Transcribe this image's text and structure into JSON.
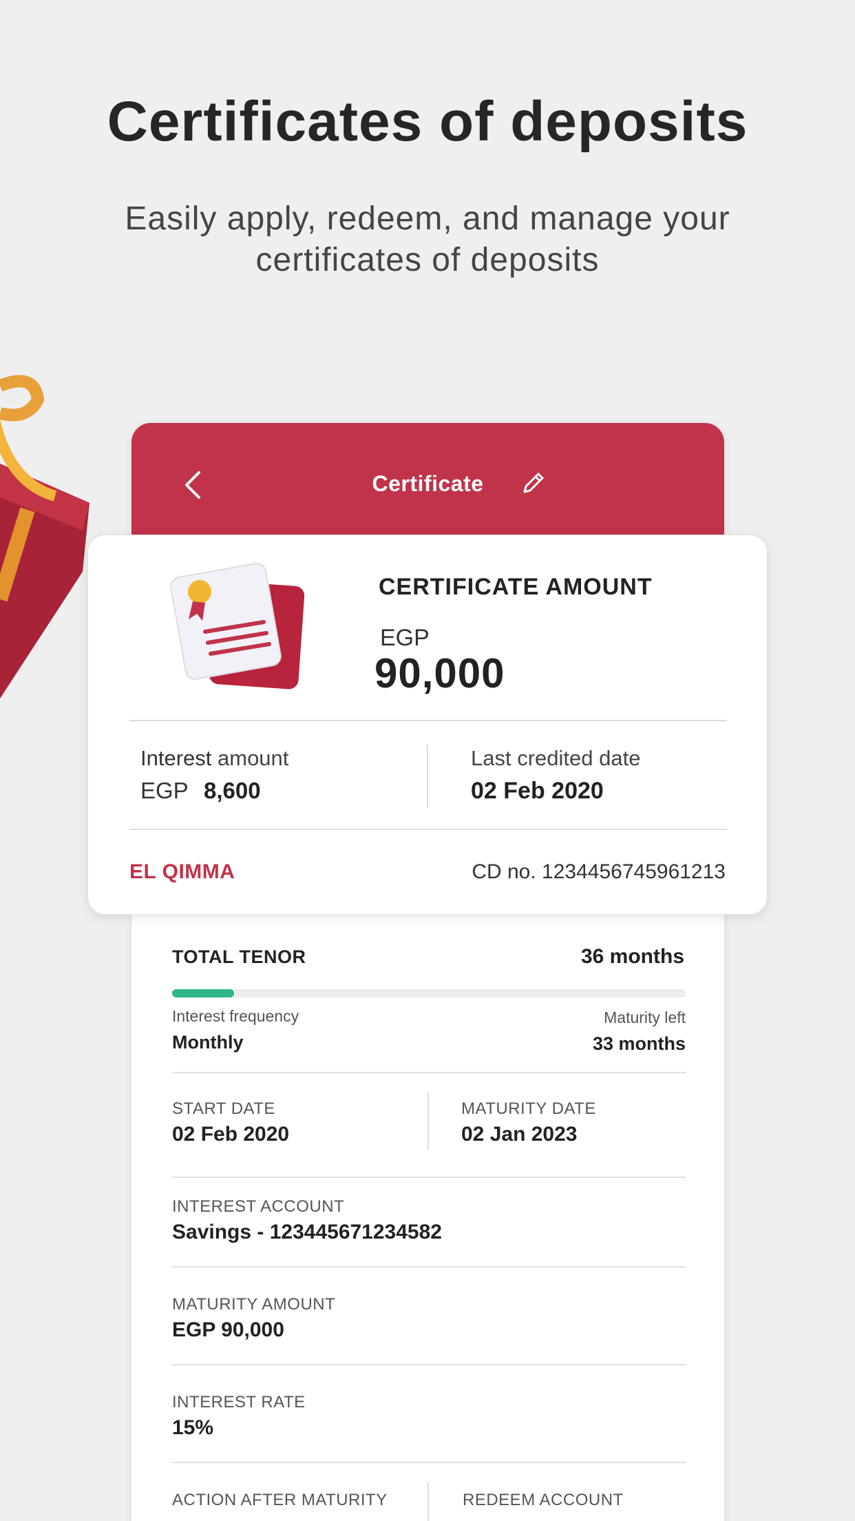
{
  "hero": {
    "title": "Certificates of deposits",
    "subtitle": "Easily apply, redeem, and manage your certificates of deposits"
  },
  "colors": {
    "brand": "#c0334a",
    "progress": "#2fb58a",
    "background": "#efefef"
  },
  "header": {
    "title": "Certificate",
    "back_icon": "chevron-left-icon",
    "edit_icon": "pencil-icon"
  },
  "card": {
    "heading": "CERTIFICATE AMOUNT",
    "currency": "EGP",
    "amount": "90,000",
    "interest_label_bold": "Interest",
    "interest_label_rest": " amount",
    "interest_currency": "EGP",
    "interest_value": "8,600",
    "credited_label": "Last credited date",
    "credited_value": "02 Feb 2020",
    "product_name": "EL QIMMA",
    "cd_number": "CD no. 1234456745961213"
  },
  "details": {
    "total_tenor_label": "TOTAL TENOR",
    "total_tenor_value": "36 months",
    "progress_fraction": 0.12,
    "interest_frequency_label": "Interest frequency",
    "interest_frequency_value": "Monthly",
    "maturity_left_label": "Maturity left",
    "maturity_left_value": "33 months",
    "start_date_label": "START DATE",
    "start_date_value": "02 Feb 2020",
    "maturity_date_label": "MATURITY DATE",
    "maturity_date_value": "02 Jan 2023",
    "interest_account_label": "INTEREST ACCOUNT",
    "interest_account_value": "Savings - 123445671234582",
    "maturity_amount_label": "MATURITY AMOUNT",
    "maturity_amount_value": "EGP 90,000",
    "interest_rate_label": "INTEREST RATE",
    "interest_rate_value": "15%",
    "action_after_maturity_label": "ACTION AFTER MATURITY",
    "redeem_account_label": "REDEEM ACCOUNT"
  }
}
